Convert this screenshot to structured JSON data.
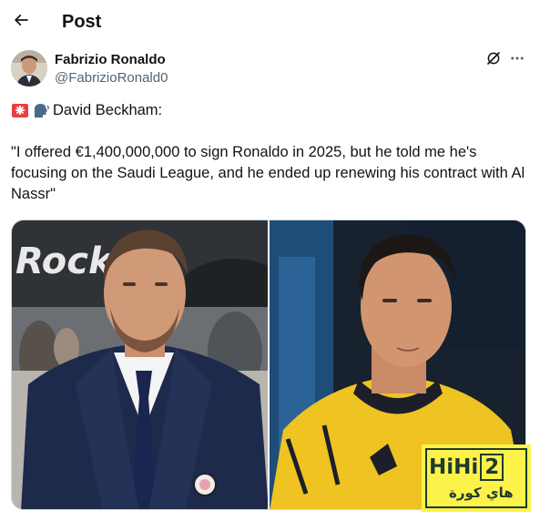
{
  "header": {
    "back_icon": "arrow-left-icon",
    "title": "Post"
  },
  "author": {
    "display_name": "Fabrizio Ronaldo",
    "handle": "@FabrizioRonald0"
  },
  "actions": {
    "grok_icon": "grok-slash-circle-icon",
    "more_icon": "more-dots-icon"
  },
  "tweet": {
    "emojis": [
      "police-light-emoji",
      "speaking-head-emoji"
    ],
    "intro": "David Beckham:",
    "quote": "\"I offered €1,400,000,000 to sign Ronaldo in 2025, but he told me he's focusing on the Saudi League, and he ended up renewing his contract with Al Nassr\""
  },
  "media": {
    "left_photo": "man-in-navy-suit-photo",
    "right_photo": "footballer-in-yellow-kit-photo",
    "left_background_text": "Rock"
  },
  "watermark": {
    "latin": "HiHi",
    "number": "2",
    "arabic": "هاي كورة",
    "bg_color": "#fdf24a"
  },
  "colors": {
    "text_primary": "#0f1419",
    "text_secondary": "#536471",
    "border": "#cfd9de"
  }
}
